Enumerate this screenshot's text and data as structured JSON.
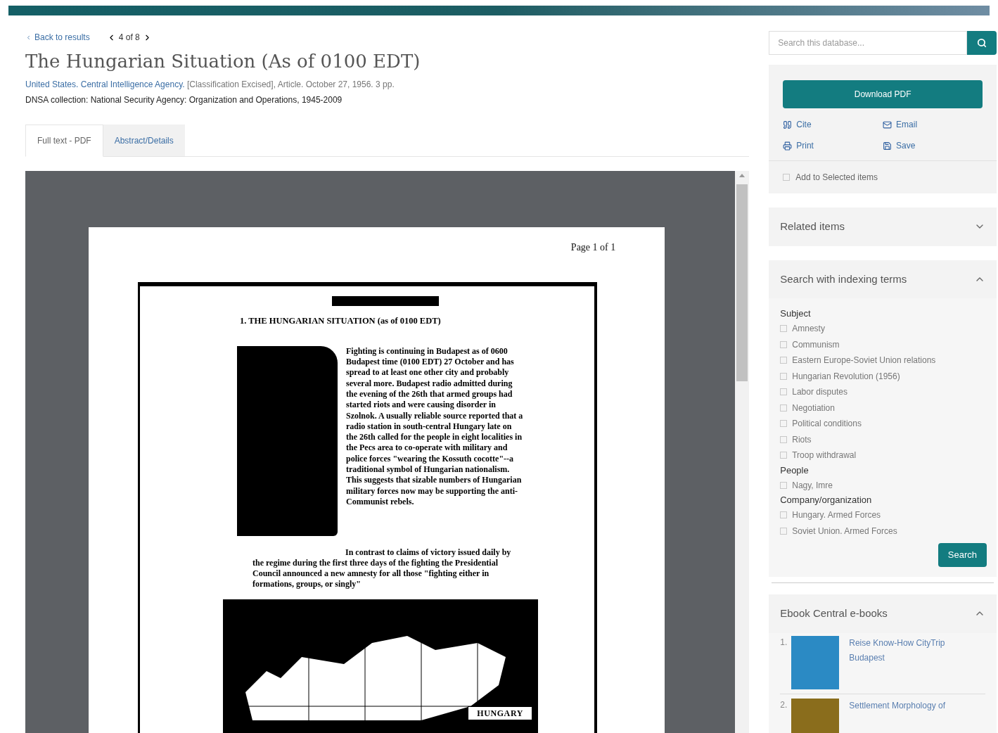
{
  "nav": {
    "back": "Back to results",
    "position": "4 of 8"
  },
  "record": {
    "title": "The Hungarian Situation (As of 0100 EDT)",
    "author": "United States. Central Intelligence Agency.",
    "meta": " [Classification Excised], Article. October 27, 1956. 3 pp.",
    "collection": "DNSA collection: National Security Agency: Organization and Operations, 1945-2009"
  },
  "tabs": [
    {
      "label": "Full text - PDF",
      "selected": true
    },
    {
      "label": "Abstract/Details",
      "selected": false
    }
  ],
  "document": {
    "page_label": "Page 1 of 1",
    "heading": "1. THE HUNGARIAN SITUATION (as of 0100 EDT)",
    "paragraph_1": "Fighting is continuing in Budapest as of 0600 Budapest time (0100 EDT) 27 October and has spread to at least one other city and probably several more. Budapest radio admitted during the evening of the 26th that armed groups had started riots and were causing disorder in Szolnok. A usually reliable source reported that a radio station in south-central Hungary late on the 26th called for the people in eight localities in the Pecs area to co-operate with military and police forces \"wearing the Kossuth cocotte\"--a traditional symbol of Hungarian nationalism. This suggests that sizable numbers of Hungarian military forces now may be supporting the anti-Communist rebels.",
    "paragraph_2": "In contrast to claims of victory issued daily by the regime during the first three days of the fighting the Presidential Council announced a new amnesty for all those \"fighting either in formations, groups, or singly\"",
    "map_label": "HUNGARY"
  },
  "search": {
    "placeholder": "Search this database..."
  },
  "actions": {
    "download": "Download PDF",
    "links": [
      {
        "kind": "cite",
        "label": "Cite"
      },
      {
        "kind": "email",
        "label": "Email"
      },
      {
        "kind": "print",
        "label": "Print"
      },
      {
        "kind": "save",
        "label": "Save"
      }
    ],
    "add_to_selected": {
      "label": "Add to Selected items",
      "checked": false
    }
  },
  "related": {
    "title": "Related items",
    "expanded": false
  },
  "indexing": {
    "title": "Search with indexing terms",
    "expanded": true,
    "groups": [
      {
        "label": "Subject",
        "terms": [
          {
            "label": "Amnesty",
            "checked": false
          },
          {
            "label": "Communism",
            "checked": false
          },
          {
            "label": "Eastern Europe-Soviet Union relations",
            "checked": false
          },
          {
            "label": "Hungarian Revolution (1956)",
            "checked": false
          },
          {
            "label": "Labor disputes",
            "checked": false
          },
          {
            "label": "Negotiation",
            "checked": false
          },
          {
            "label": "Political conditions",
            "checked": false
          },
          {
            "label": "Riots",
            "checked": false
          },
          {
            "label": "Troop withdrawal",
            "checked": false
          }
        ]
      },
      {
        "label": "People",
        "terms": [
          {
            "label": "Nagy, Imre",
            "checked": false
          }
        ]
      },
      {
        "label": "Company/organization",
        "terms": [
          {
            "label": "Hungary. Armed Forces",
            "checked": false
          },
          {
            "label": "Soviet Union. Armed Forces",
            "checked": false
          }
        ]
      }
    ],
    "button": "Search"
  },
  "ebooks": {
    "title": "Ebook Central e-books",
    "expanded": true,
    "items": [
      {
        "number": "1.",
        "title": "Reise Know-How CityTrip Budapest"
      },
      {
        "number": "2.",
        "title": "Settlement Morphology of"
      }
    ]
  }
}
